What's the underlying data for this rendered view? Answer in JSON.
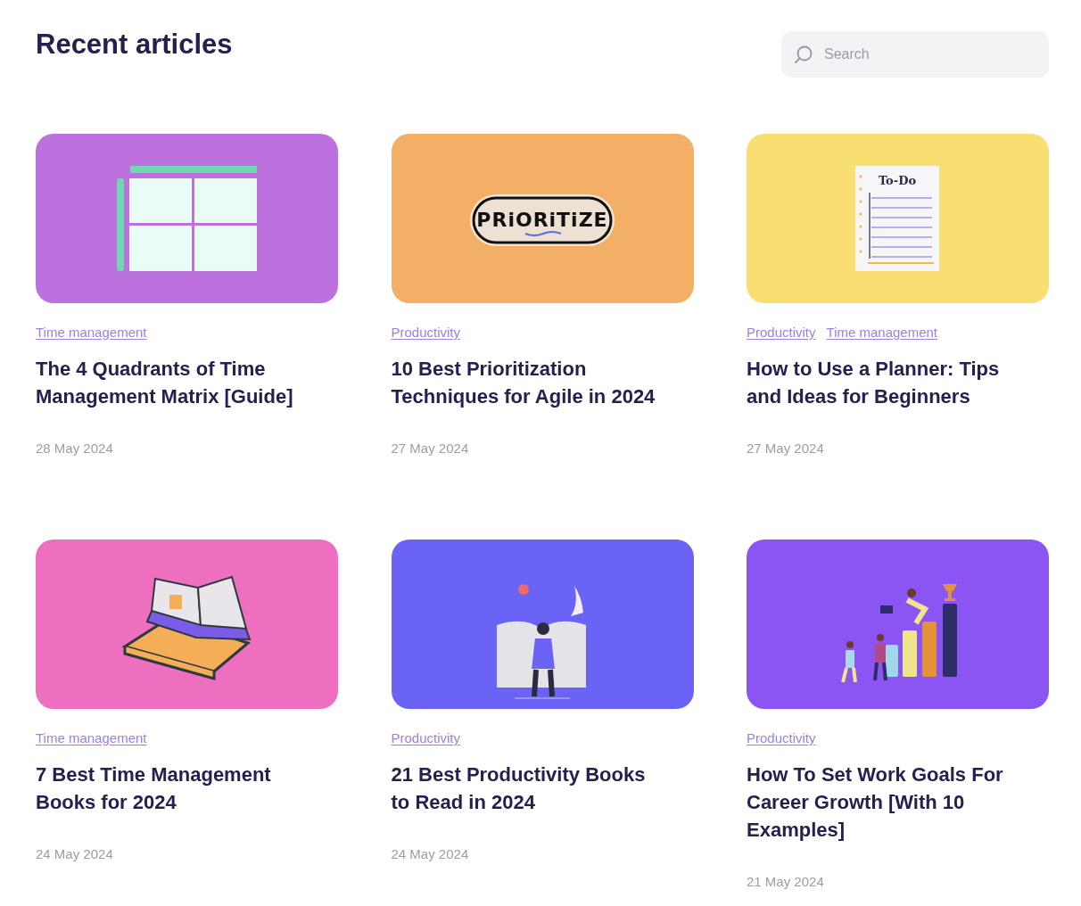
{
  "page": {
    "title": "Recent articles"
  },
  "search": {
    "placeholder": "Search"
  },
  "articles": [
    {
      "kind": "matrix",
      "color": "#bd71df",
      "tags": [
        "Time management"
      ],
      "title": "The 4 Quadrants of Time Management Matrix [Guide]",
      "date": "28 May 2024"
    },
    {
      "kind": "sticker",
      "color": "#f3af66",
      "sticker_text": "PRiORiTiZE",
      "tags": [
        "Productivity"
      ],
      "title": "10 Best Prioritization Techniques for Agile in 2024",
      "date": "27 May 2024"
    },
    {
      "kind": "todo",
      "color": "#f9de72",
      "sticker_text": "To-Do",
      "tags": [
        "Productivity",
        "Time management"
      ],
      "title": "How to Use a Planner: Tips and Ideas for Beginners",
      "date": "27 May 2024"
    },
    {
      "kind": "books",
      "color": "#ee6fc0",
      "tags": [
        "Time management"
      ],
      "title": "7 Best Time Management Books for 2024",
      "date": "24 May 2024"
    },
    {
      "kind": "reader",
      "color": "#6a63f6",
      "tags": [
        "Productivity"
      ],
      "title": "21 Best Productivity Books to Read in 2024",
      "date": "24 May 2024"
    },
    {
      "kind": "goals",
      "color": "#8a55f3",
      "tags": [
        "Productivity"
      ],
      "title": "How To Set Work Goals For Career Growth [With 10 Examples]",
      "date": "21 May 2024"
    }
  ]
}
